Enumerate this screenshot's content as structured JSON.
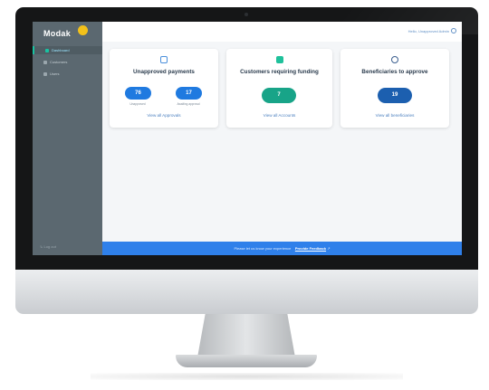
{
  "app": {
    "logo_text": "Modak"
  },
  "sidebar": {
    "items": [
      {
        "label": "Dashboard",
        "active": true
      },
      {
        "label": "Customers",
        "active": false
      },
      {
        "label": "Users",
        "active": false
      }
    ],
    "logout_label": "Log out"
  },
  "header": {
    "user_label": "Hello, Unapproved Admin"
  },
  "cards": [
    {
      "title": "Unapproved payments",
      "counts": [
        {
          "value": "76",
          "caption": "Unapproved"
        },
        {
          "value": "17",
          "caption": "Awaiting approval"
        }
      ],
      "link": "View all Approvals"
    },
    {
      "title": "Customers requiring funding",
      "counts": [
        {
          "value": "7"
        }
      ],
      "link": "View all Accounts"
    },
    {
      "title": "Beneficiaries to approve",
      "counts": [
        {
          "value": "19"
        }
      ],
      "link": "View all beneficiaries"
    }
  ],
  "banner": {
    "text": "Please let us know your experience",
    "link": "Provide Feedback"
  },
  "colors": {
    "sidebar": "#5b6870",
    "accent_blue": "#1f7ae0",
    "accent_teal": "#18a488",
    "accent_navy": "#1c5faf",
    "banner": "#2f80ea",
    "logo_dot": "#f3c11a"
  }
}
